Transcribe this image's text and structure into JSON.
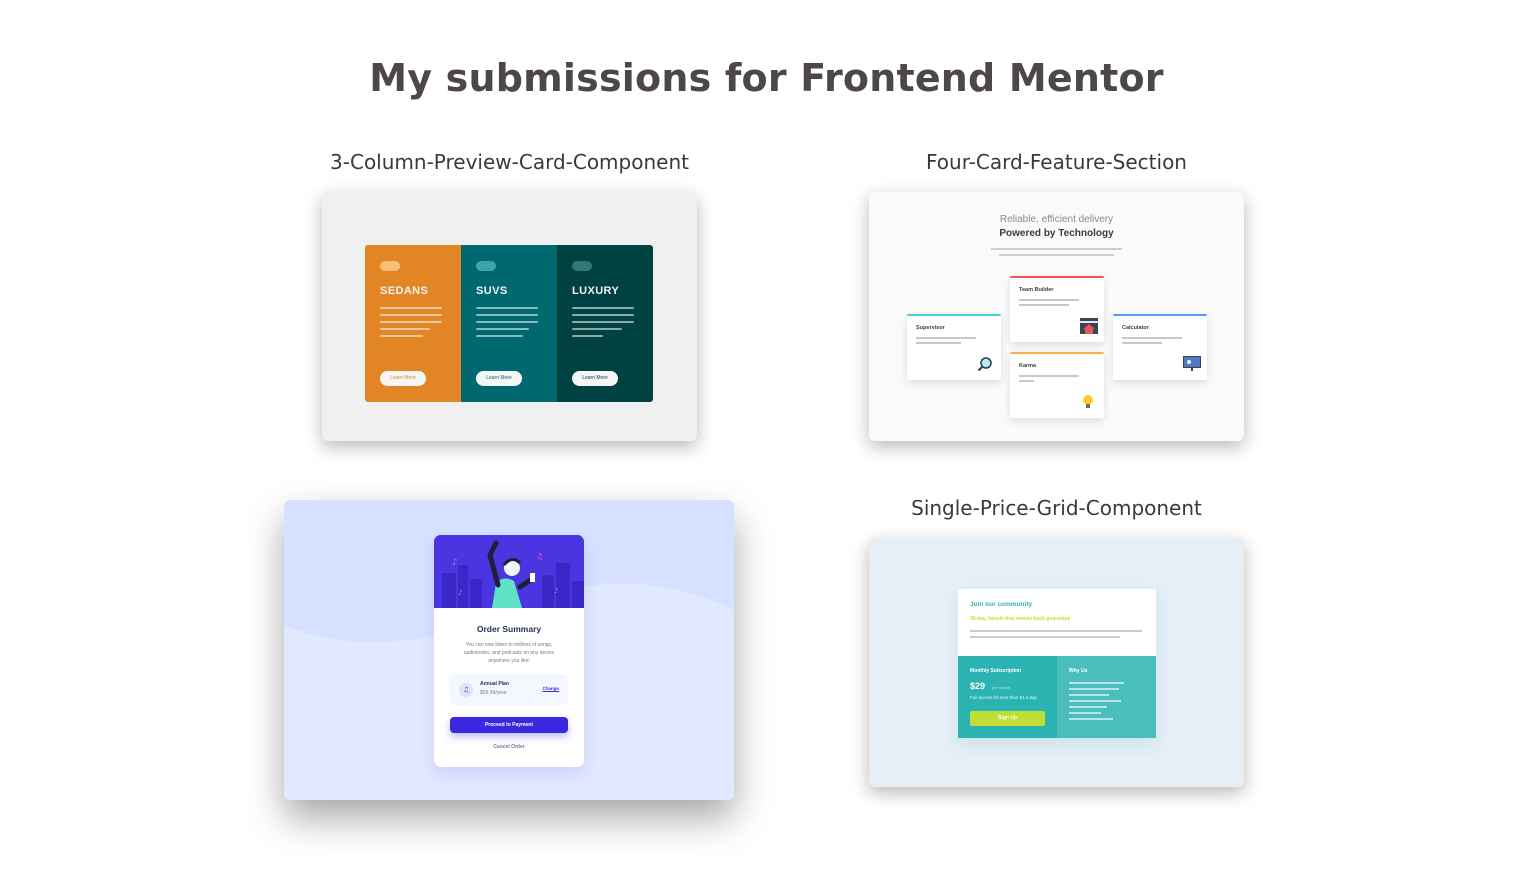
{
  "page": {
    "title": "My submissions for Frontend Mentor"
  },
  "projects": [
    {
      "title": "3-Column-Preview-Card-Component"
    },
    {
      "title": "Four-Card-Feature-Section"
    },
    {
      "title": ""
    },
    {
      "title": "Single-Price-Grid-Component"
    }
  ],
  "preview_three_column": {
    "columns": [
      {
        "name": "SEDANS",
        "button": "Learn More",
        "color": "#e28625"
      },
      {
        "name": "SUVS",
        "button": "Learn More",
        "color": "#006970"
      },
      {
        "name": "LUXURY",
        "button": "Learn More",
        "color": "#004241"
      }
    ]
  },
  "preview_four_card": {
    "heading_light": "Reliable, efficient delivery",
    "heading_bold": "Powered by Technology",
    "cards": [
      {
        "title": "Supervisor",
        "accent": "#44d3d2",
        "icon": "magnifier-icon"
      },
      {
        "title": "Team Builder",
        "accent": "#ea5454",
        "icon": "house-icon"
      },
      {
        "title": "Karma",
        "accent": "#fcaf4a",
        "icon": "lightbulb-icon"
      },
      {
        "title": "Calculator",
        "accent": "#549ef2",
        "icon": "monitor-icon"
      }
    ]
  },
  "preview_order_summary": {
    "title": "Order Summary",
    "description": "You can now listen to millions of songs, audiobooks, and podcasts on any device anywhere you like!",
    "plan_name": "Annual Plan",
    "plan_price": "$59.99/year",
    "change_link": "Change",
    "pay_button": "Proceed to Payment",
    "cancel_link": "Cancel Order"
  },
  "preview_price_grid": {
    "heading": "Join our community",
    "subheading": "30-day, hassle-free money back guarantee",
    "sub_title": "Monthly Subscription",
    "price": "$29",
    "per": "per month",
    "note": "Full access for less than $1 a day",
    "button": "Sign Up",
    "why_title": "Why Us"
  }
}
